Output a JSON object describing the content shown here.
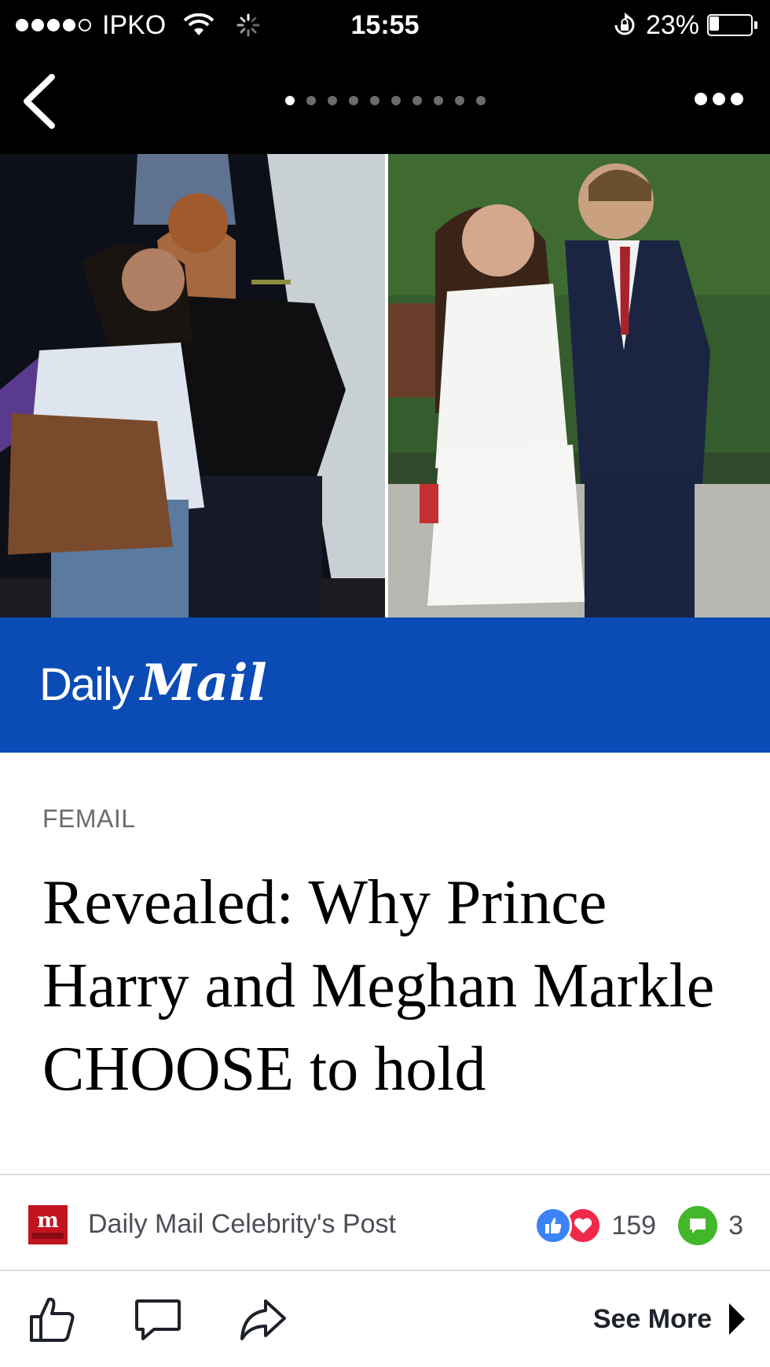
{
  "status_bar": {
    "carrier": "IPKO",
    "time": "15:55",
    "battery_percent": "23%",
    "battery_level": 0.23,
    "signal_bars_filled": 4,
    "signal_bars_total": 5
  },
  "nav": {
    "back_icon": "chevron-left-icon",
    "more_icon": "ellipsis-icon",
    "page_count": 10,
    "active_page": 1
  },
  "brand": {
    "name_part1": "Daily",
    "name_part2": "Mail",
    "color": "#0b4bb5"
  },
  "article": {
    "kicker": "FEMAIL",
    "headline": "Revealed: Why Prince Harry and Meghan Markle CHOOSE to hold"
  },
  "post": {
    "page_name": "Daily Mail Celebrity's Post",
    "reaction_count": "159",
    "comment_count": "3",
    "reactions": [
      "like-icon",
      "love-icon"
    ]
  },
  "actions": {
    "like_icon": "thumbs-up-icon",
    "comment_icon": "comment-icon",
    "share_icon": "share-icon",
    "see_more_label": "See More"
  },
  "colors": {
    "accent": "#0b4bb5",
    "like": "#3b82f6",
    "love": "#f0284a",
    "comment_badge": "#42b72a"
  }
}
